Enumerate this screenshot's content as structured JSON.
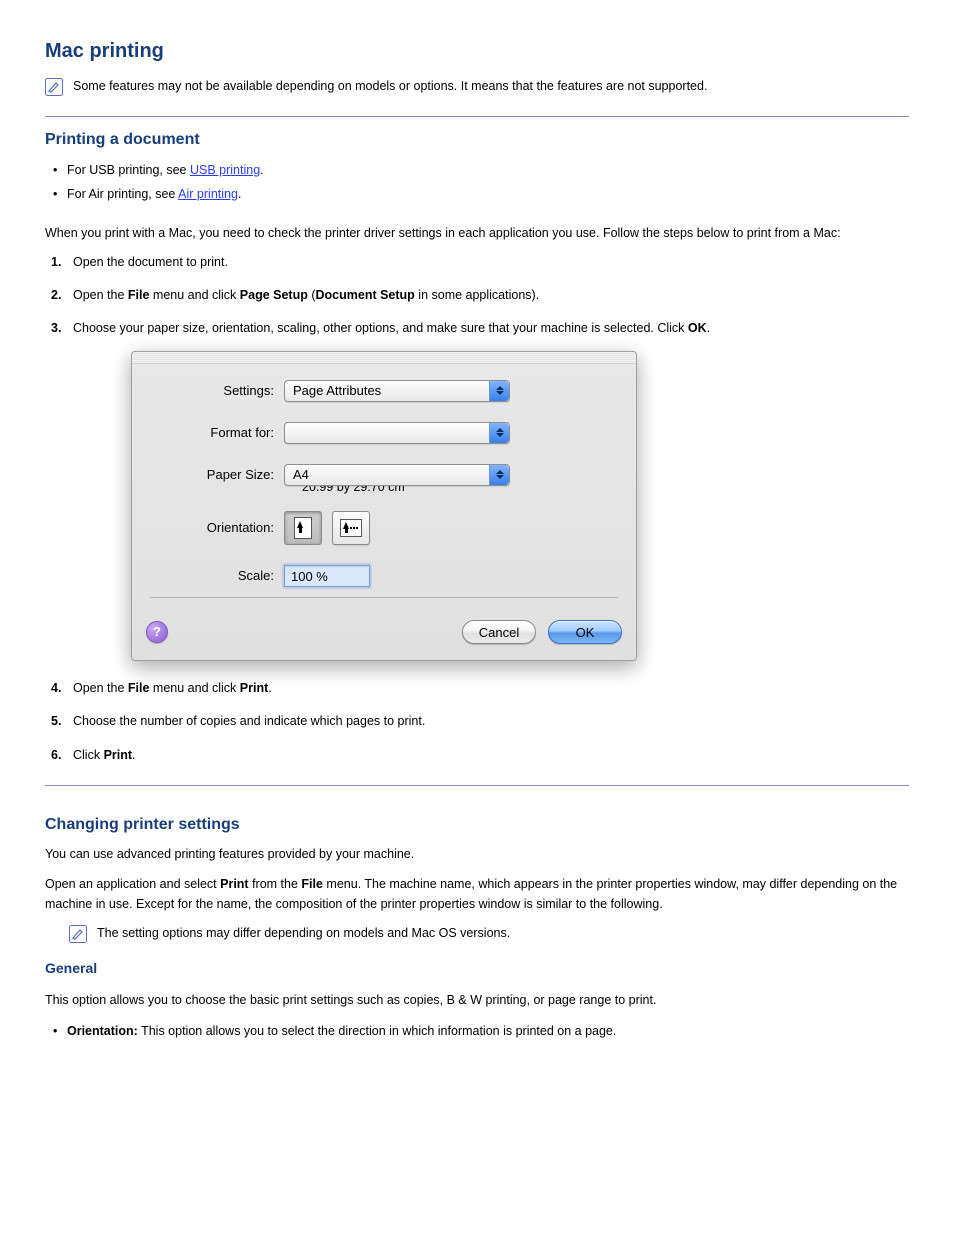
{
  "section1": {
    "title": "Mac printing",
    "note_text": "Some features may not be available depending on models or options. It means that the features are not supported."
  },
  "printing_doc": {
    "title": "Printing a document",
    "bullets": [
      {
        "prefix": "For USB printing, see ",
        "link": "USB printing",
        "suffix": "."
      },
      {
        "prefix": "For Air printing, see ",
        "link": "Air printing",
        "suffix": "."
      }
    ],
    "intro": "When you print with a Mac, you need to check the printer driver settings in each application you use. Follow the steps below to print from a Mac:",
    "steps": [
      "Open the document to print.",
      "Open the File menu and click Page Setup (Document Setup in some applications).",
      "Choose your paper size, orientation, scaling, other options, and make sure that your machine is selected. Click OK.",
      "Open the File menu and click Print.",
      "Choose the number of copies and indicate which pages to print.",
      "Click Print."
    ],
    "step2_parts": {
      "a": "Open the ",
      "b": "File",
      "c": " menu and click ",
      "d": "Page Setup",
      "e": " (",
      "f": "Document Setup",
      "g": " in some applications)."
    },
    "step3_parts": {
      "a": "Choose your paper size, orientation, scaling, other options, and make sure that your machine is selected. Click ",
      "b": "OK",
      "c": "."
    },
    "step4_parts": {
      "a": "Open the ",
      "b": "File",
      "c": " menu and click ",
      "d": "Print",
      "e": "."
    },
    "step6_parts": {
      "a": "Click ",
      "b": "Print",
      "c": "."
    }
  },
  "dialog": {
    "labels": {
      "settings": "Settings:",
      "format_for": "Format for:",
      "paper_size": "Paper Size:",
      "orientation": "Orientation:",
      "scale": "Scale:"
    },
    "settings_value": "Page Attributes",
    "format_for_value": "",
    "paper_size_value": "A4",
    "paper_size_detail": "20.99 by 29.70 cm",
    "scale_value": "100 %",
    "buttons": {
      "cancel": "Cancel",
      "ok": "OK",
      "help": "?"
    }
  },
  "section2": {
    "title": "Changing printer settings",
    "body": "You can use advanced printing features provided by your machine.",
    "open_parts": {
      "a": "Open an application and select ",
      "b": "Print",
      "c": " from the ",
      "d": "File",
      "e": " menu. The machine name, which appears in the printer properties window, may differ depending on the machine in use. Except for the name, the composition of the printer properties window is similar to the following."
    },
    "note_text": "The setting options may differ depending on models and Mac OS versions.",
    "general_title": "General",
    "general_intro": "This option allows you to choose the basic print settings such as copies, B & W printing, or page range to print.",
    "orientation_item": {
      "label": "Orientation:",
      "desc": " This option allows you to select the direction in which information is printed on a page."
    }
  }
}
